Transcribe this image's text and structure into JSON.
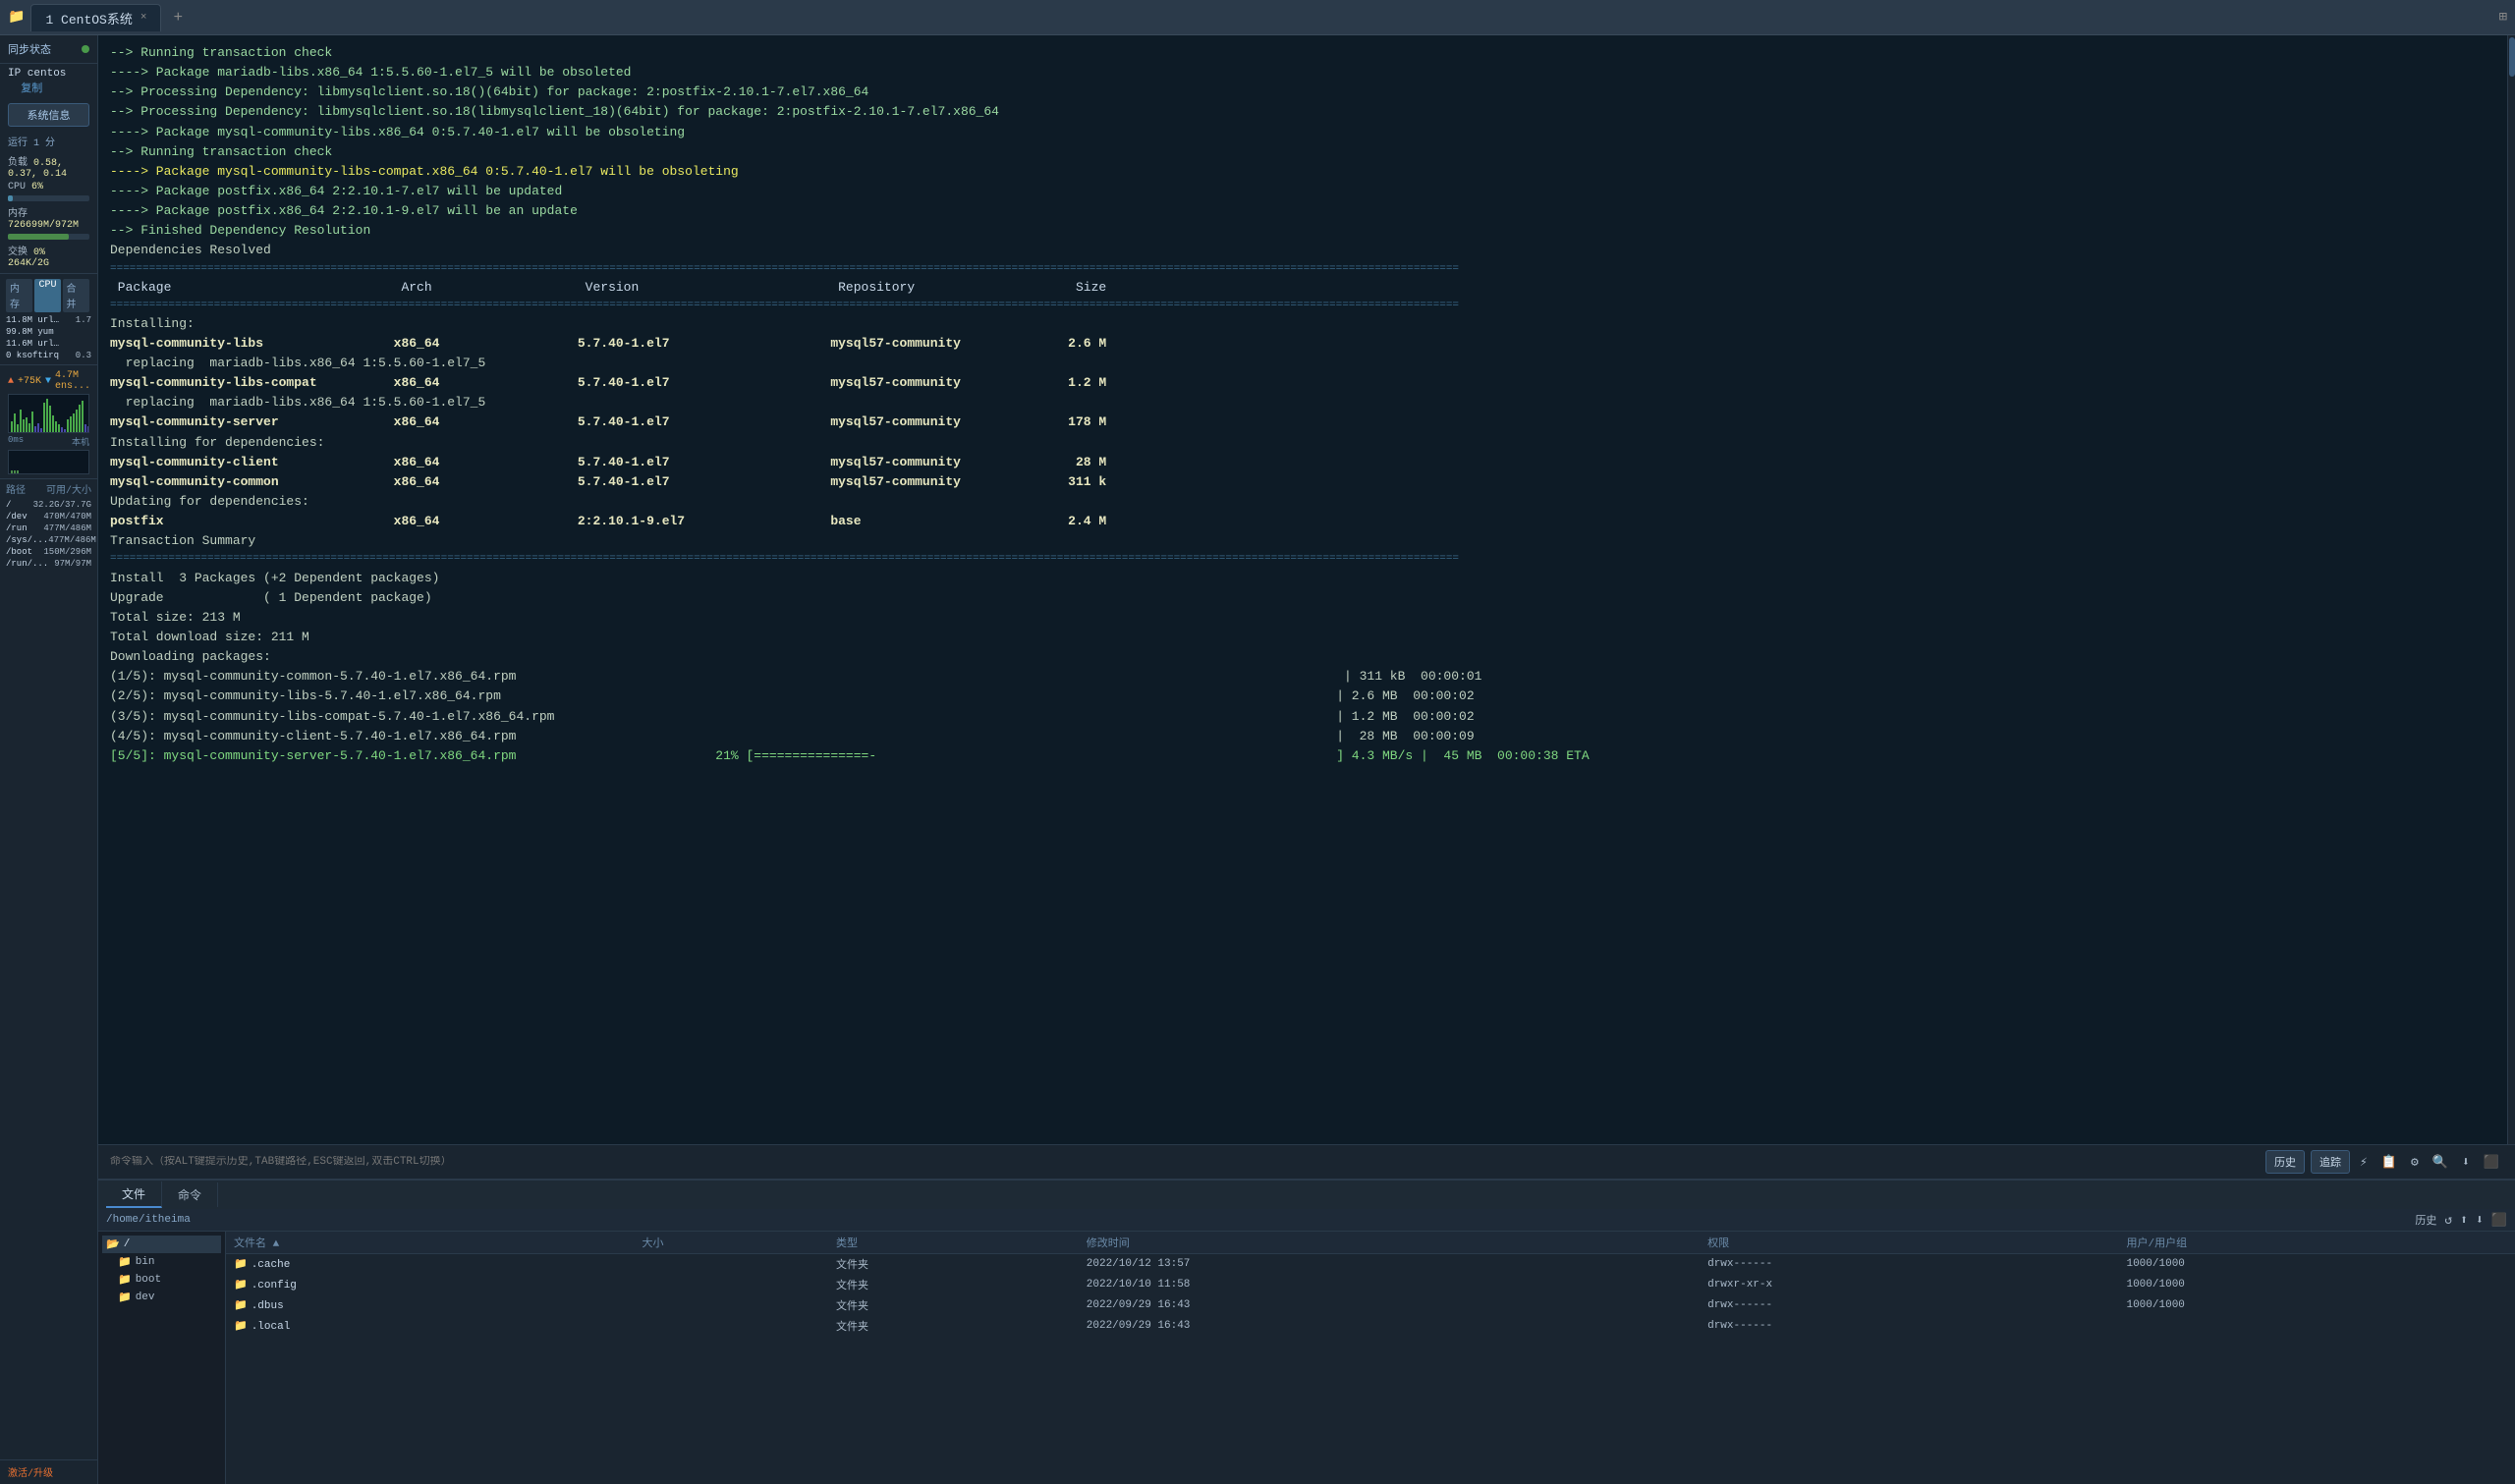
{
  "topbar": {
    "folder_icon": "📁",
    "tab_label": "1 CentOS系统",
    "close_icon": "×",
    "add_tab_icon": "+",
    "grid_icon": "⊞"
  },
  "sidebar": {
    "sync_label": "同步状态",
    "sync_dot_color": "#4a9a4a",
    "ip_label": "IP centos",
    "copy_label": "复制",
    "sysinfo_label": "系统信息",
    "runtime_label": "运行 1 分",
    "load_label": "负载",
    "load_value": "0.58, 0.37, 0.14",
    "cpu_label": "CPU",
    "cpu_value": "6%",
    "mem_label": "内存",
    "mem_value": "726699M/972M",
    "swap_label": "交换",
    "swap_value": "0%  264K/2G",
    "proc_tabs": [
      "内存",
      "CPU",
      "合并"
    ],
    "proc_active": "CPU",
    "processes": [
      {
        "name": "urlgrabl",
        "value": "11.8M",
        "cpu": "1.7"
      },
      {
        "name": "yum",
        "value": "99.8M",
        "cpu": ""
      },
      {
        "name": "urlgrabl",
        "value": "11.6M",
        "cpu": ""
      },
      {
        "name": "ksoftirq",
        "value": "0",
        "cpu": "0.3"
      }
    ],
    "net_label": "+75K  ↓4.7M ens...",
    "net_vals": [
      5.4,
      3.7,
      1.9
    ],
    "net_time_label": "0ms    本机",
    "latency_vals": [
      0,
      0,
      0
    ],
    "disk_header_left": "路径",
    "disk_header_right": "可用/大小",
    "disks": [
      {
        "path": "/",
        "avail": "32.2G/37.7G"
      },
      {
        "path": "/dev",
        "avail": "470M/470M"
      },
      {
        "path": "/run",
        "avail": "477M/486M"
      },
      {
        "path": "/sys/...",
        "avail": "477M/486M"
      },
      {
        "path": "/boot",
        "avail": "150M/296M"
      },
      {
        "path": "/run/...",
        "avail": "97M/97M"
      }
    ]
  },
  "terminal": {
    "lines": [
      {
        "text": "--> Running transaction check",
        "type": "arrow"
      },
      {
        "text": "----> Package mariadb-libs.x86_64 1:5.5.60-1.el7_5 will be obsoleted",
        "type": "arrow-dbl"
      },
      {
        "text": "--> Processing Dependency: libmysqlclient.so.18()(64bit) for package: 2:postfix-2.10.1-7.el7.x86_64",
        "type": "arrow"
      },
      {
        "text": "--> Processing Dependency: libmysqlclient.so.18(libmysqlclient_18)(64bit) for package: 2:postfix-2.10.1-7.el7.x86_64",
        "type": "arrow"
      },
      {
        "text": "----> Package mysql-community-libs.x86_64 0:5.7.40-1.el7 will be obsoleting",
        "type": "arrow-dbl"
      },
      {
        "text": "--> Running transaction check",
        "type": "arrow"
      },
      {
        "text": "----> Package mysql-community-libs-compat.x86_64 0:5.7.40-1.el7 will be obsoleting",
        "type": "arrow-dbl highlight"
      },
      {
        "text": "----> Package postfix.x86_64 2:2.10.1-7.el7 will be updated",
        "type": "arrow-dbl"
      },
      {
        "text": "----> Package postfix.x86_64 2:2.10.1-9.el7 will be an update",
        "type": "arrow-dbl"
      },
      {
        "text": "--> Finished Dependency Resolution",
        "type": "arrow"
      },
      {
        "text": "",
        "type": "normal"
      },
      {
        "text": "Dependencies Resolved",
        "type": "normal"
      },
      {
        "text": "",
        "type": "normal"
      },
      {
        "text": "================================================================================================================================================================================================================",
        "type": "separator"
      },
      {
        "text": " Package                              Arch                    Version                          Repository                     Size",
        "type": "header-line"
      },
      {
        "text": "================================================================================================================================================================================================================",
        "type": "separator"
      },
      {
        "text": "Installing:",
        "type": "normal"
      },
      {
        "text": "mysql-community-libs                 x86_64                  5.7.40-1.el7                     mysql57-community              2.6 M",
        "type": "bold-pkg"
      },
      {
        "text": "  replacing  mariadb-libs.x86_64 1:5.5.60-1.el7_5",
        "type": "normal"
      },
      {
        "text": "mysql-community-libs-compat          x86_64                  5.7.40-1.el7                     mysql57-community              1.2 M",
        "type": "bold-pkg"
      },
      {
        "text": "  replacing  mariadb-libs.x86_64 1:5.5.60-1.el7_5",
        "type": "normal"
      },
      {
        "text": "mysql-community-server               x86_64                  5.7.40-1.el7                     mysql57-community              178 M",
        "type": "bold-pkg"
      },
      {
        "text": "Installing for dependencies:",
        "type": "normal"
      },
      {
        "text": "mysql-community-client               x86_64                  5.7.40-1.el7                     mysql57-community               28 M",
        "type": "bold-pkg"
      },
      {
        "text": "mysql-community-common               x86_64                  5.7.40-1.el7                     mysql57-community              311 k",
        "type": "bold-pkg"
      },
      {
        "text": "Updating for dependencies:",
        "type": "normal"
      },
      {
        "text": "postfix                              x86_64                  2:2.10.1-9.el7                   base                           2.4 M",
        "type": "bold-pkg"
      },
      {
        "text": "",
        "type": "normal"
      },
      {
        "text": "Transaction Summary",
        "type": "normal"
      },
      {
        "text": "================================================================================================================================================================================================================",
        "type": "separator"
      },
      {
        "text": "Install  3 Packages (+2 Dependent packages)",
        "type": "normal"
      },
      {
        "text": "Upgrade             ( 1 Dependent package)",
        "type": "normal"
      },
      {
        "text": "",
        "type": "normal"
      },
      {
        "text": "Total size: 213 M",
        "type": "normal"
      },
      {
        "text": "Total download size: 211 M",
        "type": "normal"
      },
      {
        "text": "Downloading packages:",
        "type": "normal"
      },
      {
        "text": "(1/5): mysql-community-common-5.7.40-1.el7.x86_64.rpm                                                                                                            | 311 kB  00:00:01",
        "type": "normal"
      },
      {
        "text": "(2/5): mysql-community-libs-5.7.40-1.el7.x86_64.rpm                                                                                                             | 2.6 MB  00:00:02",
        "type": "normal"
      },
      {
        "text": "(3/5): mysql-community-libs-compat-5.7.40-1.el7.x86_64.rpm                                                                                                      | 1.2 MB  00:00:02",
        "type": "normal"
      },
      {
        "text": "(4/5): mysql-community-client-5.7.40-1.el7.x86_64.rpm                                                                                                           |  28 MB  00:00:09",
        "type": "normal"
      },
      {
        "text": "[5/5]: mysql-community-server-5.7.40-1.el7.x86_64.rpm                          21% [===============-                                                            ] 4.3 MB/s |  45 MB  00:00:38 ETA",
        "type": "progress green-bracket"
      }
    ]
  },
  "cmd_bar": {
    "placeholder": "命令输入（按ALT键提示历史,TAB键路径,ESC键返回,双击CTRL切换）",
    "history_btn": "历史",
    "trace_btn": "追踪",
    "tools": [
      "⚡",
      "📋",
      "⚙",
      "⬇",
      "⬛"
    ]
  },
  "bottom_tabs": [
    {
      "label": "文件",
      "active": true
    },
    {
      "label": "命令",
      "active": false
    }
  ],
  "file_manager": {
    "path": "/home/itheima",
    "history_label": "历史",
    "toolbar_icons": [
      "↺",
      "⬆",
      "⬇",
      "⬛"
    ],
    "tree": [
      {
        "name": "/",
        "level": 0,
        "selected": true,
        "expanded": true
      },
      {
        "name": "bin",
        "level": 1
      },
      {
        "name": "boot",
        "level": 1
      },
      {
        "name": "dev",
        "level": 1
      }
    ],
    "columns": [
      {
        "label": "文件名 ▲"
      },
      {
        "label": "大小"
      },
      {
        "label": "类型"
      },
      {
        "label": "修改时间"
      },
      {
        "label": "权限"
      },
      {
        "label": "用户/用户组"
      }
    ],
    "files": [
      {
        "name": ".cache",
        "size": "",
        "type": "文件夹",
        "modified": "2022/10/12 13:57",
        "perms": "drwx------",
        "owner": "1000/1000"
      },
      {
        "name": ".config",
        "size": "",
        "type": "文件夹",
        "modified": "2022/10/10 11:58",
        "perms": "drwxr-xr-x",
        "owner": "1000/1000"
      },
      {
        "name": ".dbus",
        "size": "",
        "type": "文件夹",
        "modified": "2022/09/29 16:43",
        "perms": "drwx------",
        "owner": "1000/1000"
      },
      {
        "name": ".local",
        "size": "",
        "type": "文件夹",
        "modified": "2022/09/29 16:43",
        "perms": "drwx------",
        "owner": ""
      }
    ]
  },
  "activate_label": "激活/升级"
}
